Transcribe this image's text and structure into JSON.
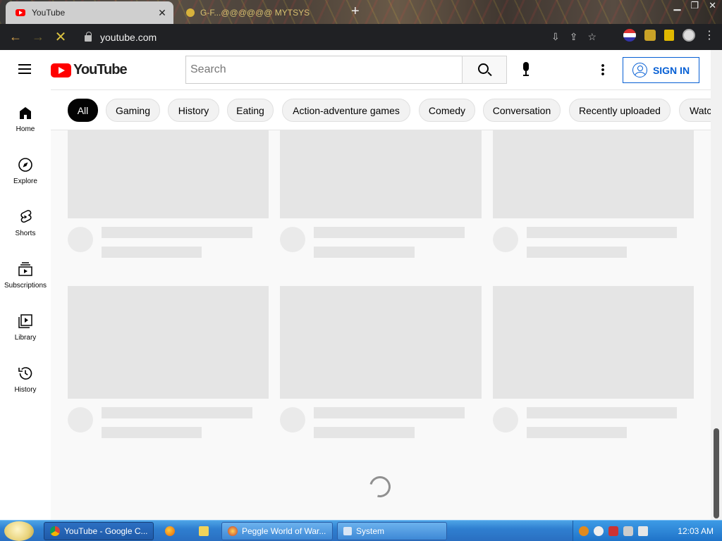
{
  "browser": {
    "active_tab_title": "YouTube",
    "inactive_tab_title": "G-F...@@@@@@ MYTSYS",
    "url": "youtube.com"
  },
  "header": {
    "logo_text": "YouTube",
    "search_placeholder": "Search",
    "signin_label": "SIGN IN"
  },
  "chips": [
    {
      "label": "All"
    },
    {
      "label": "Gaming"
    },
    {
      "label": "History"
    },
    {
      "label": "Eating"
    },
    {
      "label": "Action-adventure games"
    },
    {
      "label": "Comedy"
    },
    {
      "label": "Conversation"
    },
    {
      "label": "Recently uploaded"
    },
    {
      "label": "Watc"
    }
  ],
  "sidebar": {
    "items": [
      {
        "label": "Home",
        "icon": "home-icon"
      },
      {
        "label": "Explore",
        "icon": "compass-icon"
      },
      {
        "label": "Shorts",
        "icon": "shorts-icon"
      },
      {
        "label": "Subscriptions",
        "icon": "subscriptions-icon"
      },
      {
        "label": "Library",
        "icon": "library-icon"
      },
      {
        "label": "History",
        "icon": "history-icon"
      }
    ]
  },
  "taskbar": {
    "items": [
      {
        "label": "YouTube - Google C..."
      },
      {
        "label": "Peggle World of War..."
      },
      {
        "label": "System"
      }
    ],
    "clock": "12:03 AM"
  },
  "colors": {
    "brand_red": "#ff0000",
    "link_blue": "#065fd4",
    "placeholder_gray": "#e5e5e5"
  }
}
